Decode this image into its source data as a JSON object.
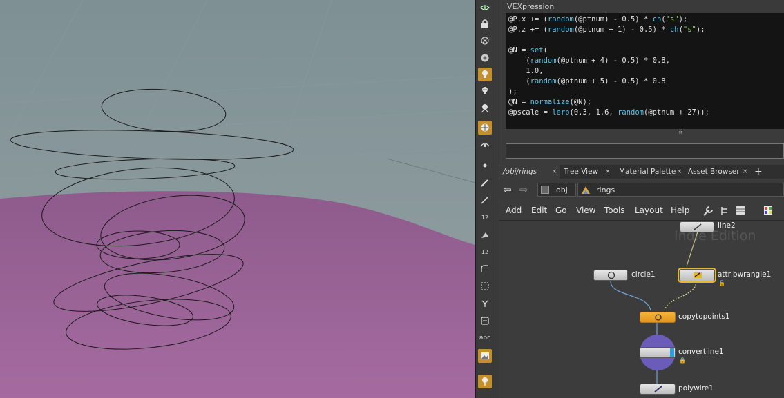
{
  "colors": {
    "viewport_bg": "#87969a",
    "ground_plane": "#9a6096",
    "wire": "#1a1a1a",
    "accent_orange": "#c4902c",
    "code_bg": "#141414",
    "code_function": "#5fc3e8",
    "code_string": "#9ad36a"
  },
  "toolbar": {
    "icons": [
      "display-options-icon",
      "lock-icon",
      "ghost-icon",
      "camera-icon",
      "light-icon",
      "skull-light-icon",
      "spot-light-icon",
      "env-light-icon",
      "snap-icon",
      "point-icon",
      "brush-icon",
      "pen-icon",
      "numbered-pen-icon",
      "sculpt-icon",
      "numbered-sculpt-icon",
      "curve-icon",
      "lattice-icon",
      "branch-icon",
      "box-icon",
      "text-icon",
      "image-icon",
      "pin-icon"
    ],
    "numbered_pen_label": "12",
    "numbered_sculpt_label": "12",
    "text_label": "abc"
  },
  "vex": {
    "title": "VEXpression",
    "lines": [
      "@P.x += (random(@ptnum) - 0.5) * ch(\"s\");",
      "@P.z += (random(@ptnum + 1) - 0.5) * ch(\"s\");",
      "",
      "@N = set(",
      "    (random(@ptnum + 4) - 0.5) * 0.8,",
      "    1.0,",
      "    (random(@ptnum + 5) - 0.5) * 0.8",
      ");",
      "@N = normalize(@N);",
      "@pscale = lerp(0.3, 1.6, random(@ptnum + 27));"
    ],
    "grip": "⠿"
  },
  "tabs": [
    {
      "label": "/obj/rings",
      "close": "×"
    },
    {
      "label": "Tree View",
      "close": "×"
    },
    {
      "label": "Material Palette",
      "close": "×"
    },
    {
      "label": "Asset Browser",
      "close": "×"
    }
  ],
  "tab_add": "+",
  "path": {
    "back": "⇦",
    "forward": "⇨",
    "root": "obj",
    "current": "rings"
  },
  "menu": [
    "Add",
    "Edit",
    "Go",
    "View",
    "Tools",
    "Layout",
    "Help"
  ],
  "network": {
    "watermark": "Indie Edition",
    "nodes": {
      "line2": "line2",
      "circle1": "circle1",
      "attribwrangle1": "attribwrangle1",
      "copytopoints1": "copytopoints1",
      "convertline1": "convertline1",
      "polywire1": "polywire1"
    }
  }
}
